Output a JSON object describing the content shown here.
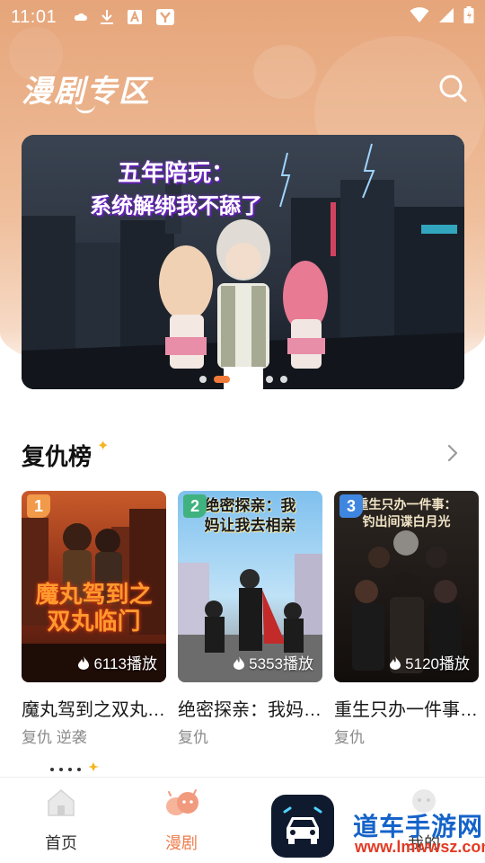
{
  "status_bar": {
    "time": "11:01"
  },
  "header": {
    "title": "漫剧专区"
  },
  "banner": {
    "title_line1": "五年陪玩：",
    "title_line2": "系统解绑我不舔了",
    "slide_count": 6,
    "active_index": 1
  },
  "section": {
    "title": "复仇榜"
  },
  "cards": [
    {
      "rank": "1",
      "plays": "6113播放",
      "name": "魔丸驾到之双丸临门",
      "tags": "复仇 逆袭",
      "art_text": "魔丸驾到之双丸临门",
      "rank_color": "#f19a4a"
    },
    {
      "rank": "2",
      "plays": "5353播放",
      "name": "绝密探亲：我妈让我去相亲",
      "tags": "复仇",
      "art_text": "绝密探亲：我妈让我去相亲",
      "rank_color": "#3fb27f"
    },
    {
      "rank": "3",
      "plays": "5120播放",
      "name": "重生只办一件事：钓出间谍白月光",
      "tags": "复仇",
      "art_text": "重生只办一件事：钓出间谍白月光",
      "rank_color": "#3f86e0"
    }
  ],
  "nav": {
    "home": "首页",
    "drama": "漫剧",
    "mine": "我的"
  },
  "watermark": {
    "line1": "道车手游网",
    "line2": "www.lmwwsz.com"
  },
  "colors": {
    "accent": "#ef7d4e",
    "header_bg": "#e6a57a"
  }
}
